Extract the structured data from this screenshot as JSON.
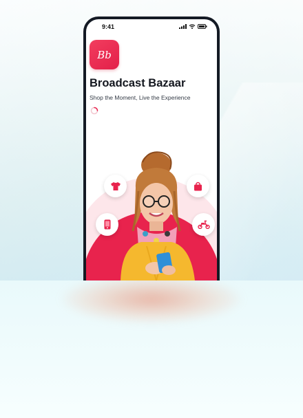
{
  "phone": {
    "status_time": "9:41",
    "app_icon_text": "Bb",
    "app_title": "Broadcast Bazaar",
    "tagline": "Shop the Moment, Live the Experience"
  },
  "floating_icons": [
    "tshirt-icon",
    "shopping-bag-icon",
    "smartphone-icon",
    "scooter-icon"
  ],
  "colors": {
    "brand": "#e8234d",
    "brand_light": "#fde6ea",
    "frame": "#141a24"
  }
}
